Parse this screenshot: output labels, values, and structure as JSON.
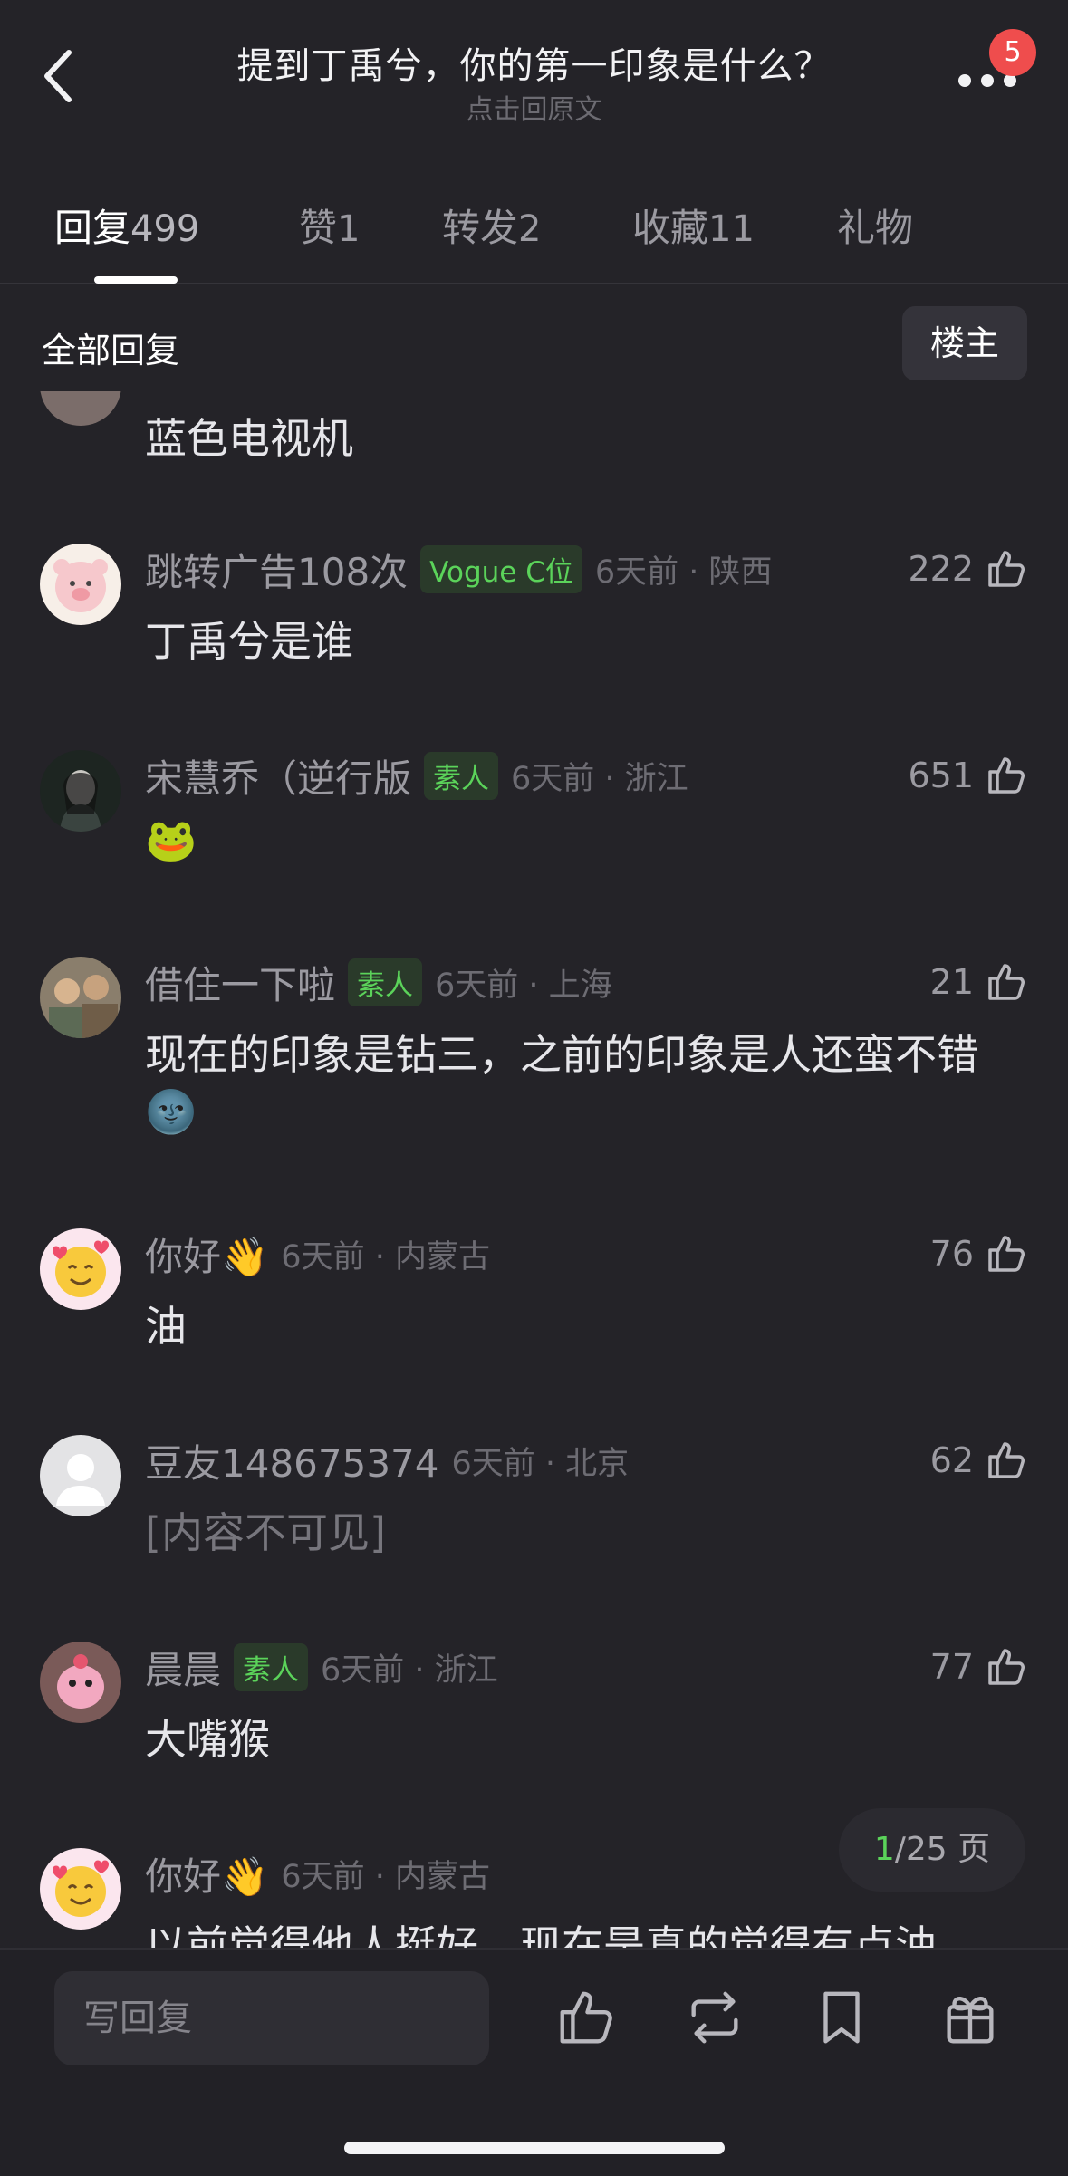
{
  "header": {
    "title": "提到丁禹兮，你的第一印象是什么？",
    "subtitle": "点击回原文",
    "notification_count": "5"
  },
  "tabs": [
    {
      "label": "回复",
      "count": "499",
      "active": true
    },
    {
      "label": "赞",
      "count": "1"
    },
    {
      "label": "转发",
      "count": "2"
    },
    {
      "label": "收藏",
      "count": "11"
    },
    {
      "label": "礼物",
      "count": ""
    }
  ],
  "filter": {
    "section_label": "全部回复",
    "op_button": "楼主"
  },
  "comments": [
    {
      "text": "蓝色电视机"
    },
    {
      "name": "跳转广告108次",
      "tag": "Vogue C位",
      "time": "6天前 · 陕西",
      "likes": "222",
      "text": "丁禹兮是谁"
    },
    {
      "name": "宋慧乔（逆行版",
      "tag": "素人",
      "time": "6天前 · 浙江",
      "likes": "651",
      "text": "🐸"
    },
    {
      "name": "借住一下啦",
      "tag": "素人",
      "time": "6天前 · 上海",
      "likes": "21",
      "text": "现在的印象是钻三，之前的印象是人还蛮不错",
      "text2": "🌚"
    },
    {
      "name": "你好👋",
      "tag": "",
      "time": "6天前 · 内蒙古",
      "likes": "76",
      "text": "油"
    },
    {
      "name": "豆友148675374",
      "tag": "",
      "time": "6天前 · 北京",
      "likes": "62",
      "text": "[内容不可见]"
    },
    {
      "name": "晨晨",
      "tag": "素人",
      "time": "6天前 · 浙江",
      "likes": "77",
      "text": "大嘴猴"
    },
    {
      "name": "你好👋",
      "tag": "",
      "time": "6天前 · 内蒙古",
      "likes": "",
      "text": "以前觉得他人挺好，现在是真的觉得有点油"
    }
  ],
  "pagination": {
    "current": "1",
    "total_text": "/25 页"
  },
  "bottom_bar": {
    "reply_placeholder": "写回复"
  },
  "colors": {
    "background": "#242328",
    "accent_green": "#5bd35a",
    "badge_red": "#ef4d4d"
  }
}
